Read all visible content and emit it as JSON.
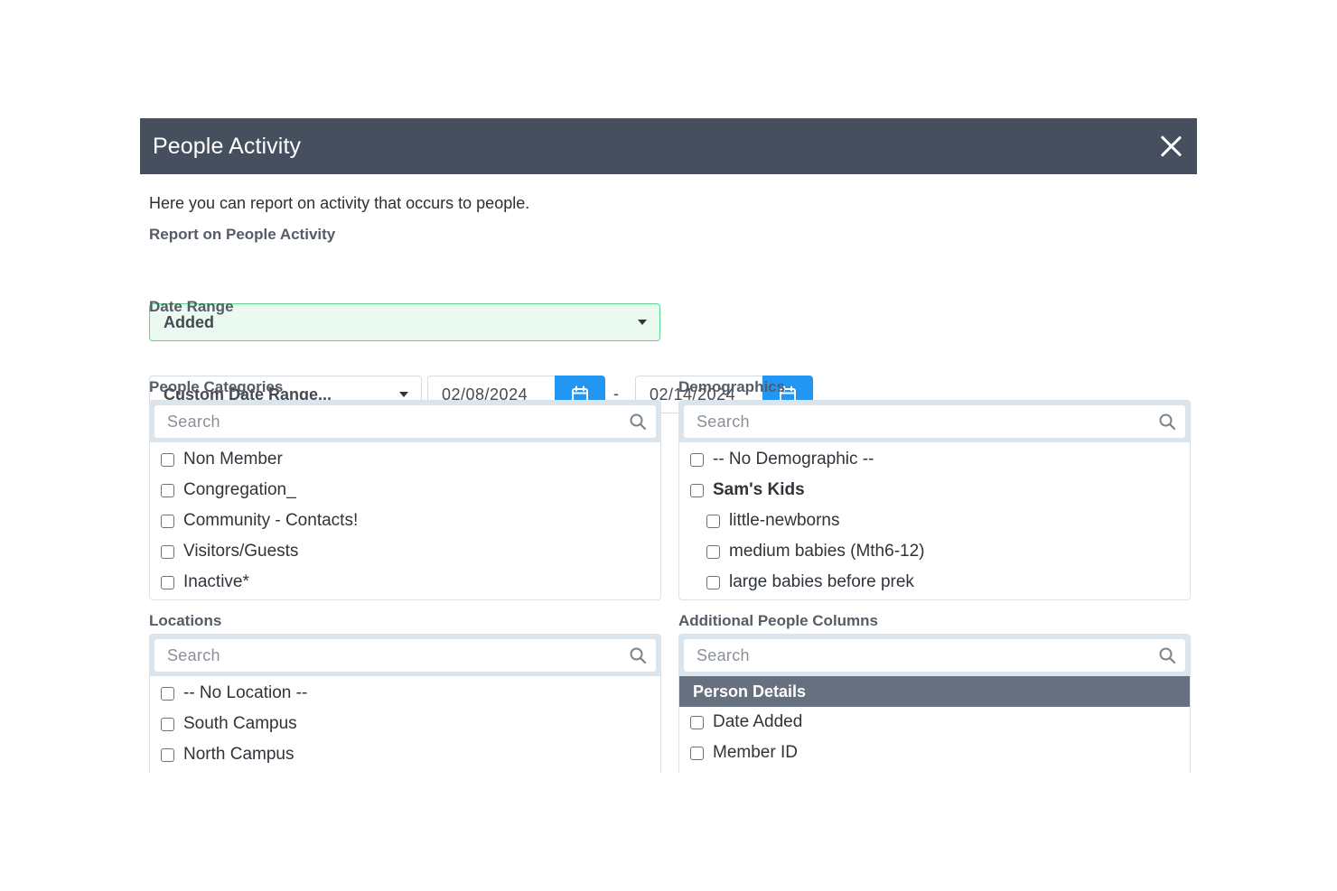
{
  "modal": {
    "title": "People Activity",
    "intro": "Here you can report on activity that occurs to people."
  },
  "activity": {
    "label": "Report on People Activity",
    "selected": "Added"
  },
  "date_range": {
    "label": "Date Range",
    "selected": "Custom Date Range...",
    "start": "02/08/2024",
    "end": "02/14/2024",
    "separator": "-"
  },
  "categories": {
    "label": "People Categories",
    "search_placeholder": "Search",
    "items": [
      "Non Member",
      "Congregation_",
      "Community - Contacts!",
      "Visitors/Guests",
      "Inactive*"
    ]
  },
  "demographics": {
    "label": "Demographics",
    "search_placeholder": "Search",
    "items": [
      {
        "label": "-- No Demographic --"
      },
      {
        "label": "Sam's Kids"
      },
      {
        "label": "little-newborns"
      },
      {
        "label": "medium babies (Mth6-12)"
      },
      {
        "label": "large babies before prek"
      }
    ]
  },
  "locations": {
    "label": "Locations",
    "search_placeholder": "Search",
    "items": [
      "-- No Location --",
      "South Campus",
      "North Campus"
    ]
  },
  "additional_columns": {
    "label": "Additional People Columns",
    "search_placeholder": "Search",
    "group": "Person Details",
    "items": [
      "Date Added",
      "Member ID"
    ]
  },
  "colors": {
    "header_bg": "#454f5e",
    "accent_blue": "#2196f3",
    "active_select_border": "#5fd58f",
    "active_select_bg": "#eafaf0",
    "group_header_bg": "#66707e"
  }
}
